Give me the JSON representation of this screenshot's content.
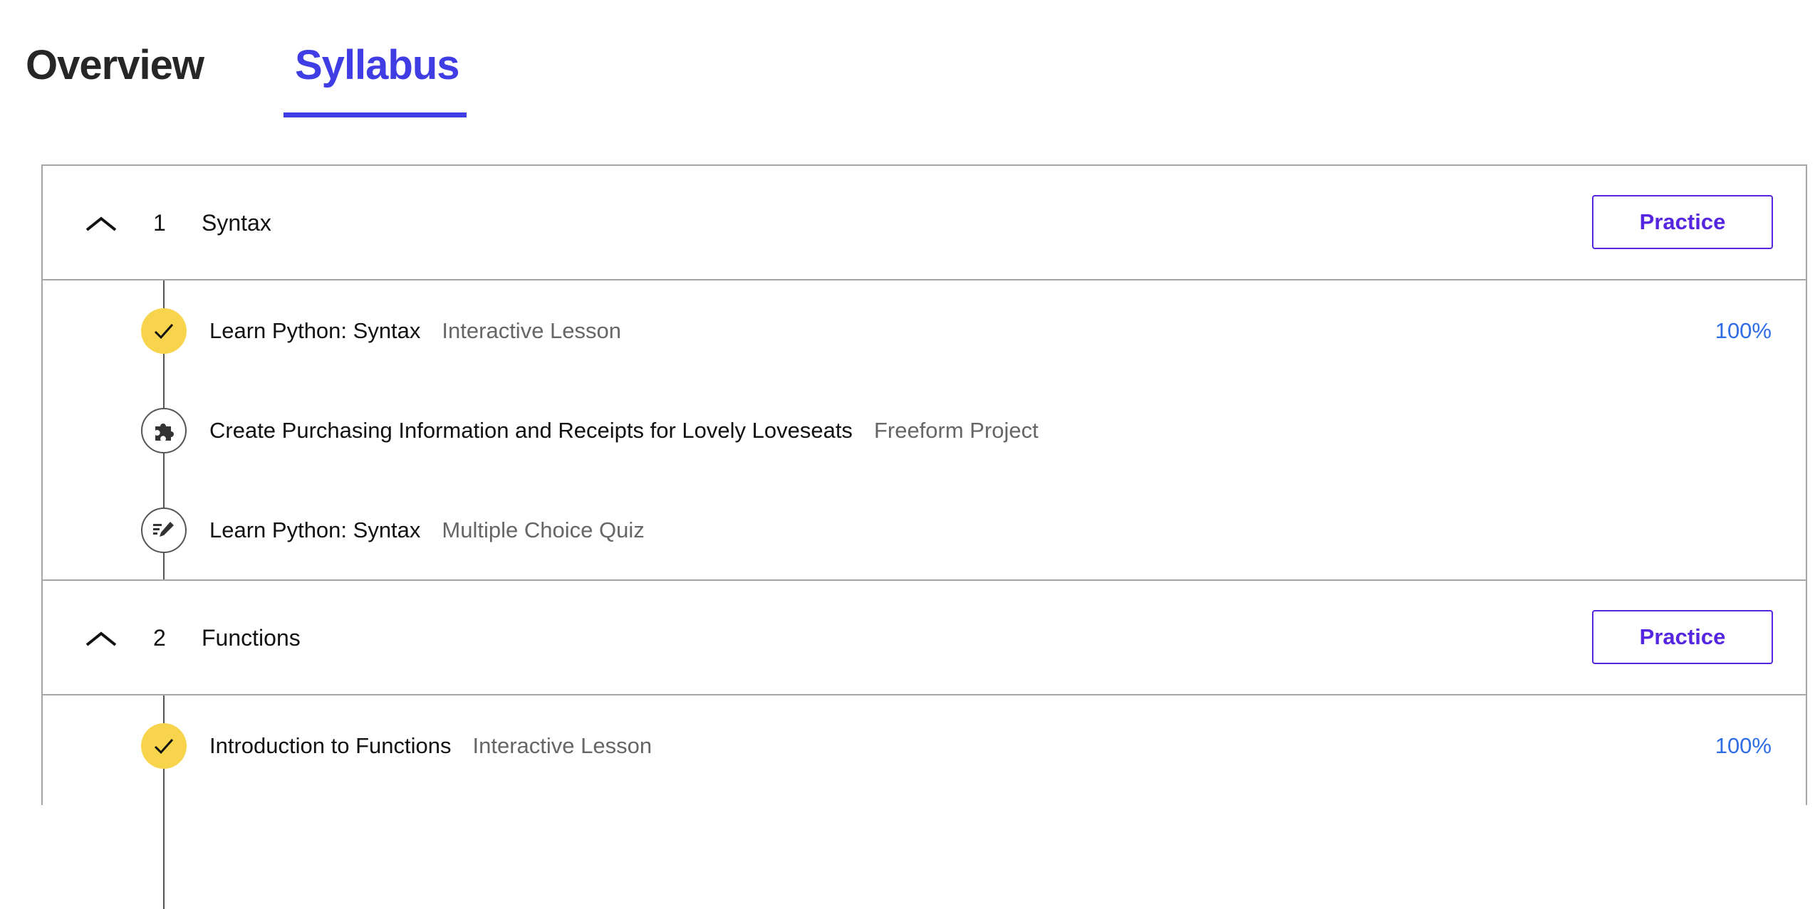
{
  "tabs": [
    {
      "label": "Overview",
      "active": false
    },
    {
      "label": "Syllabus",
      "active": true
    }
  ],
  "colors": {
    "accent": "#3f3de3",
    "button": "#5525e0",
    "progress": "#2f6de6",
    "complete": "#f8d44c"
  },
  "sections": [
    {
      "number": "1",
      "title": "Syntax",
      "button": "Practice",
      "items": [
        {
          "title": "Learn Python: Syntax",
          "type": "Interactive Lesson",
          "progress": "100%",
          "icon": "check-icon"
        },
        {
          "title": "Create Purchasing Information and Receipts for Lovely Loveseats",
          "type": "Freeform Project",
          "icon": "puzzle-icon"
        },
        {
          "title": "Learn Python: Syntax",
          "type": "Multiple Choice Quiz",
          "icon": "quiz-pencil-icon"
        }
      ]
    },
    {
      "number": "2",
      "title": "Functions",
      "button": "Practice",
      "items": [
        {
          "title": "Introduction to Functions",
          "type": "Interactive Lesson",
          "progress": "100%",
          "icon": "check-icon"
        }
      ]
    }
  ]
}
